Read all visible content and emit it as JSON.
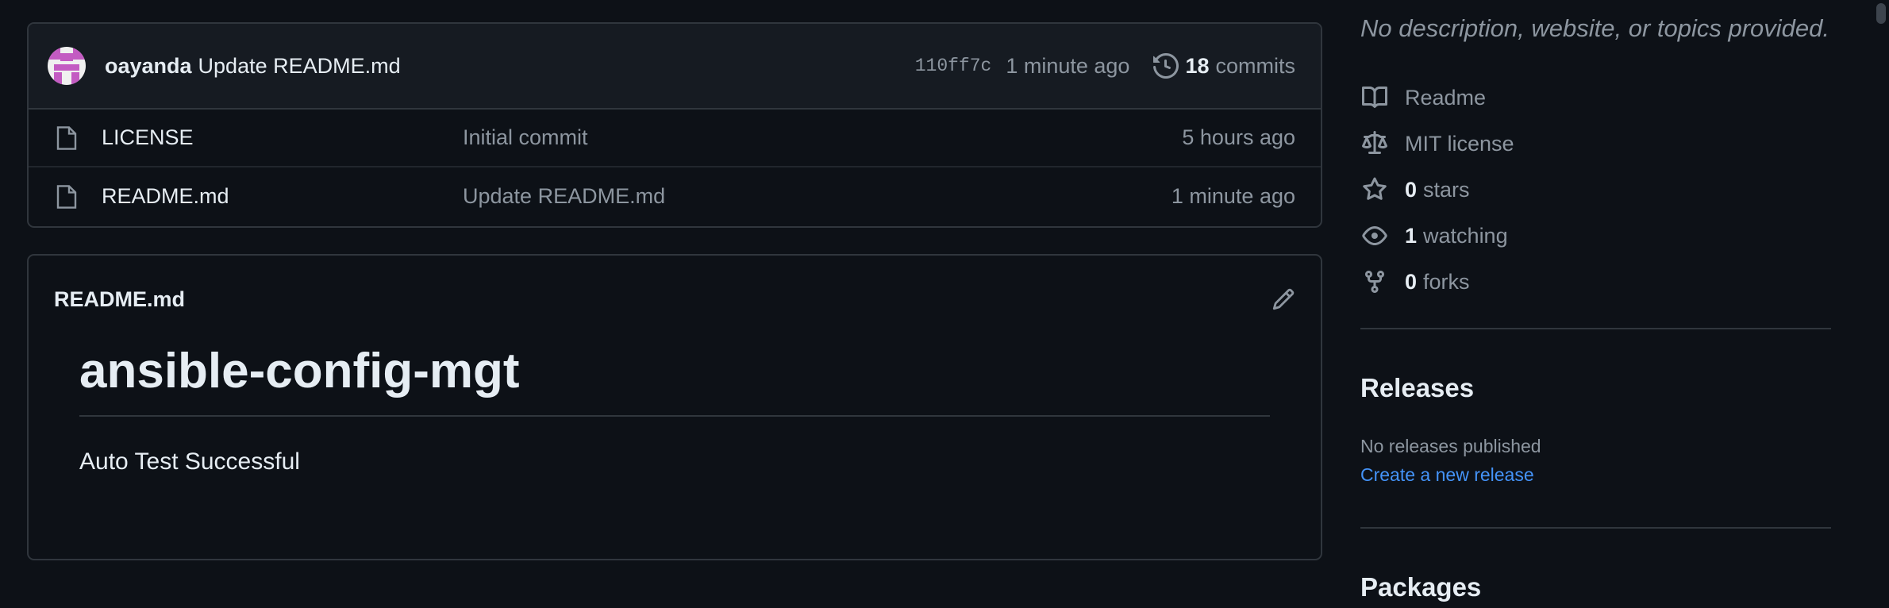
{
  "latest_commit": {
    "author": "oayanda",
    "message": "Update README.md",
    "sha": "110ff7c",
    "time": "1 minute ago",
    "commit_count": "18",
    "commit_word": "commits"
  },
  "files": [
    {
      "name": "LICENSE",
      "message": "Initial commit",
      "time": "5 hours ago",
      "icon": "file-icon"
    },
    {
      "name": "README.md",
      "message": "Update README.md",
      "time": "1 minute ago",
      "icon": "file-icon"
    }
  ],
  "readme": {
    "title": "README.md",
    "heading": "ansible-config-mgt",
    "paragraph": "Auto Test Successful"
  },
  "sidebar": {
    "description": "No description, website, or topics provided.",
    "meta": [
      {
        "icon": "book-icon",
        "num": "",
        "label": "Readme"
      },
      {
        "icon": "scale-icon",
        "num": "",
        "label": "MIT license"
      },
      {
        "icon": "star-icon",
        "num": "0",
        "label": "stars"
      },
      {
        "icon": "eye-icon",
        "num": "1",
        "label": "watching"
      },
      {
        "icon": "fork-icon",
        "num": "0",
        "label": "forks"
      }
    ],
    "releases": {
      "title": "Releases",
      "none": "No releases published",
      "create_link": "Create a new release"
    },
    "packages": {
      "title": "Packages"
    }
  },
  "colors": {
    "background": "#0d1117",
    "border": "#30363d",
    "muted": "#8d96a0",
    "link": "#4493f8",
    "avatar": "#c35bc2"
  }
}
